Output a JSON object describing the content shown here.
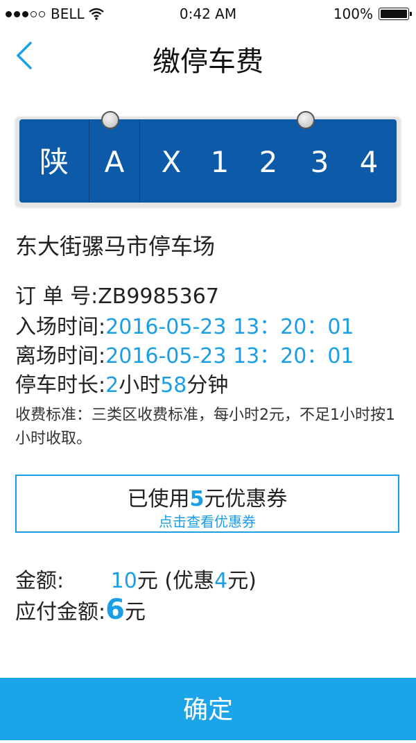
{
  "status_bar": {
    "carrier": "BELL",
    "signal_bars_filled": 3,
    "signal_bars_total": 5,
    "time": "0:42 AM",
    "battery": "100%"
  },
  "nav": {
    "title": "缴停车费",
    "back_icon": "chevron-left-icon"
  },
  "plate": {
    "province": "陕",
    "letter": "A",
    "chars": [
      "X",
      "1",
      "2",
      "3",
      "4"
    ]
  },
  "parking": {
    "lot_name": "东大街骡马市停车场",
    "order_label": "订 单 号:",
    "order_no": "ZB9985367",
    "entry_label": "入场时间:",
    "entry_time": "2016-05-23 13：20：01",
    "exit_label": "离场时间:",
    "exit_time": "2016-05-23 13：20：01",
    "duration_label": "停车时长:",
    "duration_hours": "2",
    "duration_hours_unit": "小时",
    "duration_minutes": "58",
    "duration_minutes_unit": "分钟",
    "rule": "收费标准：三类区收费标准，每小时2元，不足1小时按1小时收取。"
  },
  "coupon": {
    "prefix": "已使用",
    "amount": "5",
    "suffix": "元优惠券",
    "link": "点击查看优惠券"
  },
  "payment": {
    "amount_label": "金额:",
    "amount_value": "10",
    "amount_unit": "元 (优惠",
    "discount_value": "4",
    "discount_unit": "元)",
    "due_label": "应付金额:",
    "due_value": "6",
    "due_unit": "元"
  },
  "confirm_label": "确定",
  "colors": {
    "accent": "#1a9ee6",
    "button": "#1ba5e8",
    "plate": "#0d5aa8"
  }
}
